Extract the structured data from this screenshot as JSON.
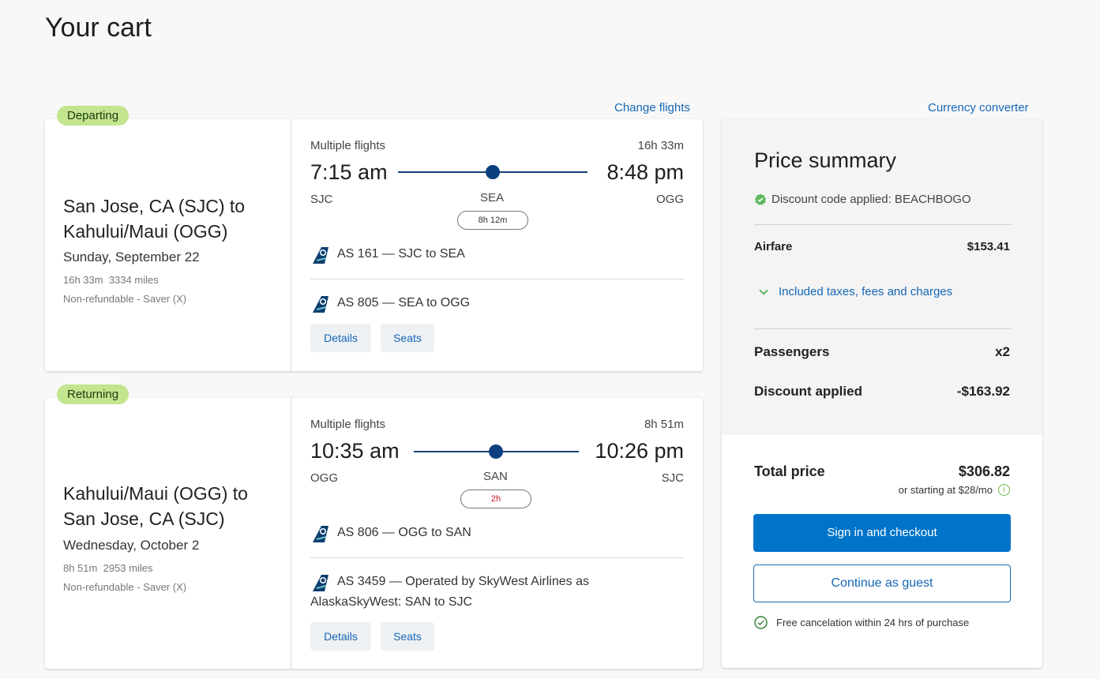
{
  "page": {
    "title": "Your cart"
  },
  "links": {
    "change_flights": "Change flights",
    "currency_converter": "Currency converter"
  },
  "departing": {
    "badge": "Departing",
    "route_line1": "San Jose, CA (SJC) to",
    "route_line2": "Kahului/Maui (OGG)",
    "date": "Sunday, September 22",
    "duration": "16h 33m",
    "miles": "3334 miles",
    "fare": "Non-refundable - Saver (X)",
    "flights_label": "Multiple flights",
    "total_duration": "16h 33m",
    "depart_time": "7:15 am",
    "arrive_time": "8:48 pm",
    "origin": "SJC",
    "stop": "SEA",
    "destination": "OGG",
    "layover": "8h 12m",
    "segments": [
      {
        "text": "AS 161 — SJC to SEA"
      },
      {
        "text": "AS 805 — SEA to OGG"
      }
    ],
    "details_label": "Details",
    "seats_label": "Seats"
  },
  "returning": {
    "badge": "Returning",
    "route_line1": "Kahului/Maui (OGG) to",
    "route_line2": "San Jose, CA (SJC)",
    "date": "Wednesday, October 2",
    "duration": "8h 51m",
    "miles": "2953 miles",
    "fare": "Non-refundable - Saver (X)",
    "flights_label": "Multiple flights",
    "total_duration": "8h 51m",
    "depart_time": "10:35 am",
    "arrive_time": "10:26 pm",
    "origin": "OGG",
    "stop": "SAN",
    "destination": "SJC",
    "layover": "2h",
    "segments": [
      {
        "text": "AS 806 — OGG to SAN"
      },
      {
        "text": "AS 3459 — Operated by SkyWest Airlines as",
        "text2": "AlaskaSkyWest: SAN to SJC"
      }
    ],
    "details_label": "Details",
    "seats_label": "Seats"
  },
  "summary": {
    "title": "Price summary",
    "discount_note": "Discount code applied: BEACHBOGO",
    "airfare_label": "Airfare",
    "airfare_value": "$153.41",
    "taxes_label": "Included taxes, fees and charges",
    "passengers_label": "Passengers",
    "passengers_value": "x2",
    "discount_label": "Discount applied",
    "discount_value": "-$163.92",
    "total_label": "Total price",
    "total_value": "$306.82",
    "monthly": "or starting at $28/mo",
    "checkout_label": "Sign in and checkout",
    "guest_label": "Continue as guest",
    "cancel_note": "Free cancelation within 24 hrs of purchase"
  },
  "colors": {
    "accent": "#0074c8",
    "link": "#1567b5",
    "badge": "#c2e58e",
    "route_line": "#1a3f75",
    "discount_check": "#4caf50"
  }
}
